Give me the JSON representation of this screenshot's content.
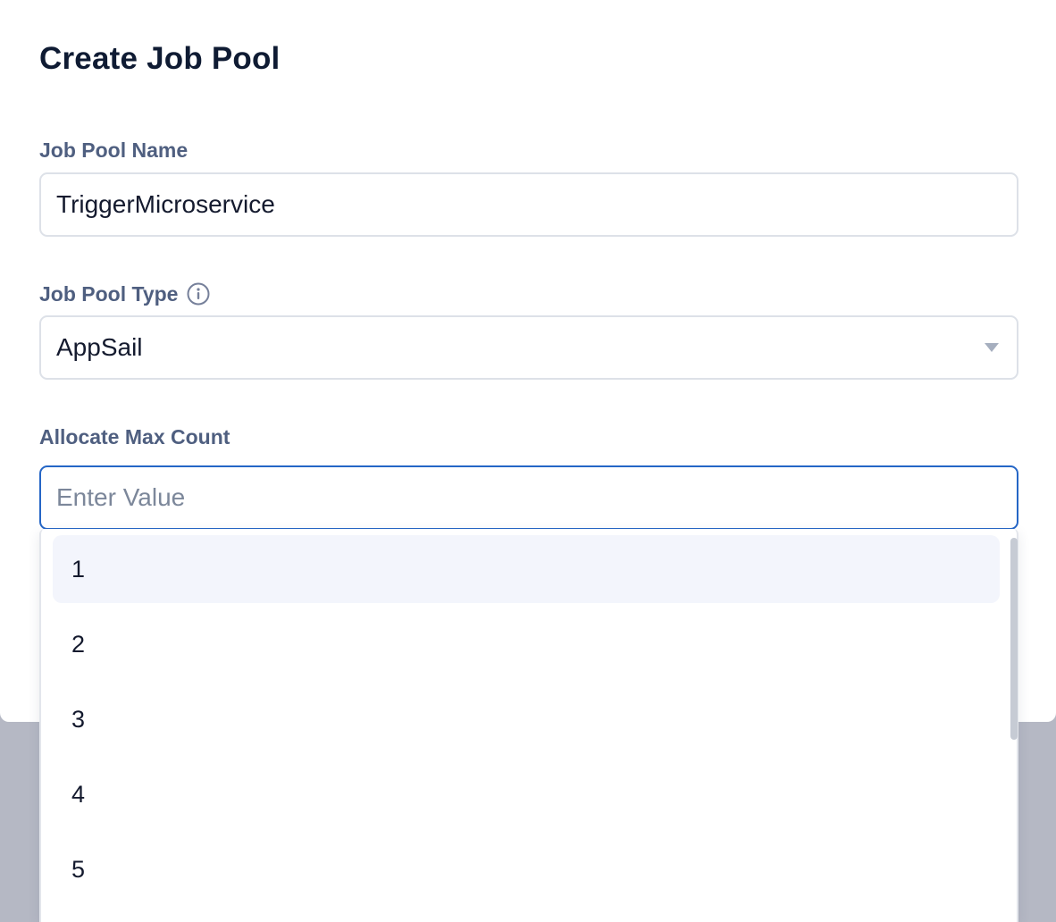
{
  "dialog": {
    "title": "Create Job Pool"
  },
  "job_pool_name": {
    "label": "Job Pool Name",
    "value": "TriggerMicroservice"
  },
  "job_pool_type": {
    "label": "Job Pool Type",
    "value": "AppSail",
    "info_icon": "info-icon",
    "dropdown_icon": "chevron-down-icon"
  },
  "max_count": {
    "label": "Allocate Max Count",
    "value": "",
    "placeholder": "Enter Value",
    "options": [
      "1",
      "2",
      "3",
      "4",
      "5"
    ],
    "highlighted_option": "1"
  },
  "colors": {
    "focus_border": "#2566c6",
    "label": "#4f5f80",
    "highlight_bg": "#f3f5fc",
    "backdrop": "#b5b8c4"
  }
}
